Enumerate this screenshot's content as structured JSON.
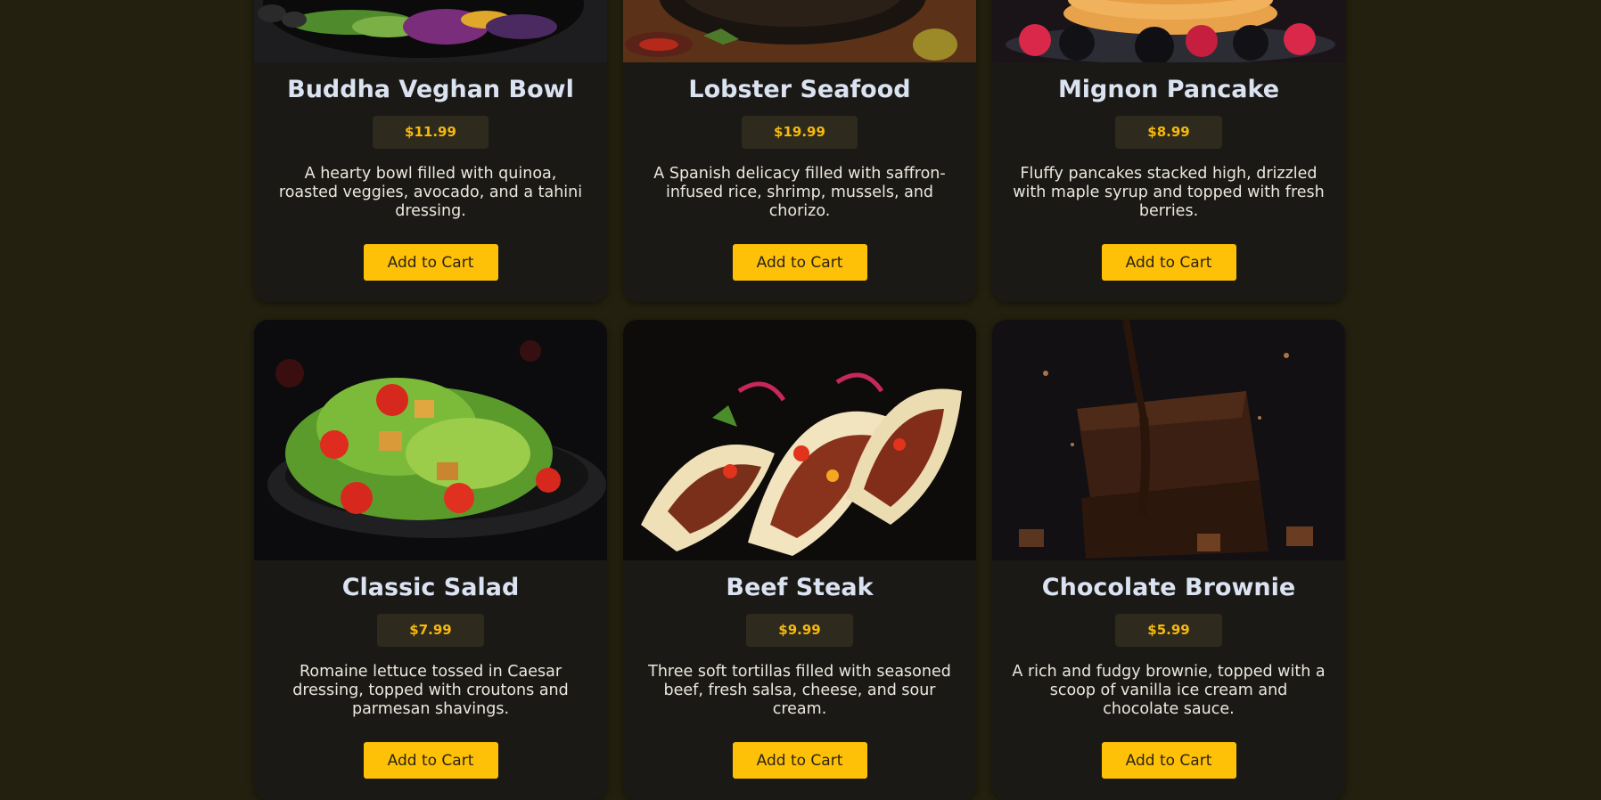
{
  "menu": {
    "items": [
      {
        "name": "Buddha Veghan Bowl",
        "price": "$11.99",
        "description": "A hearty bowl filled with quinoa, roasted veggies, avocado, and a tahini dressing.",
        "button": "Add to Cart",
        "image": "buddha-bowl-photo"
      },
      {
        "name": "Lobster Seafood",
        "price": "$19.99",
        "description": "A Spanish delicacy filled with saffron-infused rice, shrimp, mussels, and chorizo.",
        "button": "Add to Cart",
        "image": "paella-photo"
      },
      {
        "name": "Mignon Pancake",
        "price": "$8.99",
        "description": "Fluffy pancakes stacked high, drizzled with maple syrup and topped with fresh berries.",
        "button": "Add to Cart",
        "image": "pancake-photo"
      },
      {
        "name": "Classic Salad",
        "price": "$7.99",
        "description": "Romaine lettuce tossed in Caesar dressing, topped with croutons and parmesan shavings.",
        "button": "Add to Cart",
        "image": "salad-photo"
      },
      {
        "name": "Beef Steak",
        "price": "$9.99",
        "description": "Three soft tortillas filled with seasoned beef, fresh salsa, cheese, and sour cream.",
        "button": "Add to Cart",
        "image": "tacos-photo"
      },
      {
        "name": "Chocolate Brownie",
        "price": "$5.99",
        "description": "A rich and fudgy brownie, topped with a scoop of vanilla ice cream and chocolate sauce.",
        "button": "Add to Cart",
        "image": "brownie-photo"
      }
    ]
  },
  "colors": {
    "page_background": "#23200f",
    "card_background": "#1b1915",
    "accent": "#ffc107",
    "price_text": "#f7b90c",
    "title_text": "#dbe3f2"
  }
}
